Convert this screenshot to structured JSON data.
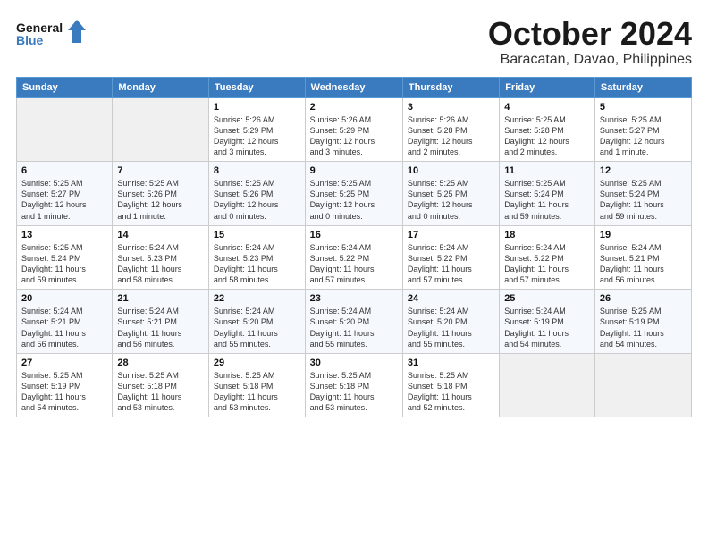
{
  "header": {
    "logo_line1": "General",
    "logo_line2": "Blue",
    "month": "October 2024",
    "location": "Baracatan, Davao, Philippines"
  },
  "weekdays": [
    "Sunday",
    "Monday",
    "Tuesday",
    "Wednesday",
    "Thursday",
    "Friday",
    "Saturday"
  ],
  "weeks": [
    [
      {
        "day": "",
        "info": ""
      },
      {
        "day": "",
        "info": ""
      },
      {
        "day": "1",
        "info": "Sunrise: 5:26 AM\nSunset: 5:29 PM\nDaylight: 12 hours\nand 3 minutes."
      },
      {
        "day": "2",
        "info": "Sunrise: 5:26 AM\nSunset: 5:29 PM\nDaylight: 12 hours\nand 3 minutes."
      },
      {
        "day": "3",
        "info": "Sunrise: 5:26 AM\nSunset: 5:28 PM\nDaylight: 12 hours\nand 2 minutes."
      },
      {
        "day": "4",
        "info": "Sunrise: 5:25 AM\nSunset: 5:28 PM\nDaylight: 12 hours\nand 2 minutes."
      },
      {
        "day": "5",
        "info": "Sunrise: 5:25 AM\nSunset: 5:27 PM\nDaylight: 12 hours\nand 1 minute."
      }
    ],
    [
      {
        "day": "6",
        "info": "Sunrise: 5:25 AM\nSunset: 5:27 PM\nDaylight: 12 hours\nand 1 minute."
      },
      {
        "day": "7",
        "info": "Sunrise: 5:25 AM\nSunset: 5:26 PM\nDaylight: 12 hours\nand 1 minute."
      },
      {
        "day": "8",
        "info": "Sunrise: 5:25 AM\nSunset: 5:26 PM\nDaylight: 12 hours\nand 0 minutes."
      },
      {
        "day": "9",
        "info": "Sunrise: 5:25 AM\nSunset: 5:25 PM\nDaylight: 12 hours\nand 0 minutes."
      },
      {
        "day": "10",
        "info": "Sunrise: 5:25 AM\nSunset: 5:25 PM\nDaylight: 12 hours\nand 0 minutes."
      },
      {
        "day": "11",
        "info": "Sunrise: 5:25 AM\nSunset: 5:24 PM\nDaylight: 11 hours\nand 59 minutes."
      },
      {
        "day": "12",
        "info": "Sunrise: 5:25 AM\nSunset: 5:24 PM\nDaylight: 11 hours\nand 59 minutes."
      }
    ],
    [
      {
        "day": "13",
        "info": "Sunrise: 5:25 AM\nSunset: 5:24 PM\nDaylight: 11 hours\nand 59 minutes."
      },
      {
        "day": "14",
        "info": "Sunrise: 5:24 AM\nSunset: 5:23 PM\nDaylight: 11 hours\nand 58 minutes."
      },
      {
        "day": "15",
        "info": "Sunrise: 5:24 AM\nSunset: 5:23 PM\nDaylight: 11 hours\nand 58 minutes."
      },
      {
        "day": "16",
        "info": "Sunrise: 5:24 AM\nSunset: 5:22 PM\nDaylight: 11 hours\nand 57 minutes."
      },
      {
        "day": "17",
        "info": "Sunrise: 5:24 AM\nSunset: 5:22 PM\nDaylight: 11 hours\nand 57 minutes."
      },
      {
        "day": "18",
        "info": "Sunrise: 5:24 AM\nSunset: 5:22 PM\nDaylight: 11 hours\nand 57 minutes."
      },
      {
        "day": "19",
        "info": "Sunrise: 5:24 AM\nSunset: 5:21 PM\nDaylight: 11 hours\nand 56 minutes."
      }
    ],
    [
      {
        "day": "20",
        "info": "Sunrise: 5:24 AM\nSunset: 5:21 PM\nDaylight: 11 hours\nand 56 minutes."
      },
      {
        "day": "21",
        "info": "Sunrise: 5:24 AM\nSunset: 5:21 PM\nDaylight: 11 hours\nand 56 minutes."
      },
      {
        "day": "22",
        "info": "Sunrise: 5:24 AM\nSunset: 5:20 PM\nDaylight: 11 hours\nand 55 minutes."
      },
      {
        "day": "23",
        "info": "Sunrise: 5:24 AM\nSunset: 5:20 PM\nDaylight: 11 hours\nand 55 minutes."
      },
      {
        "day": "24",
        "info": "Sunrise: 5:24 AM\nSunset: 5:20 PM\nDaylight: 11 hours\nand 55 minutes."
      },
      {
        "day": "25",
        "info": "Sunrise: 5:24 AM\nSunset: 5:19 PM\nDaylight: 11 hours\nand 54 minutes."
      },
      {
        "day": "26",
        "info": "Sunrise: 5:25 AM\nSunset: 5:19 PM\nDaylight: 11 hours\nand 54 minutes."
      }
    ],
    [
      {
        "day": "27",
        "info": "Sunrise: 5:25 AM\nSunset: 5:19 PM\nDaylight: 11 hours\nand 54 minutes."
      },
      {
        "day": "28",
        "info": "Sunrise: 5:25 AM\nSunset: 5:18 PM\nDaylight: 11 hours\nand 53 minutes."
      },
      {
        "day": "29",
        "info": "Sunrise: 5:25 AM\nSunset: 5:18 PM\nDaylight: 11 hours\nand 53 minutes."
      },
      {
        "day": "30",
        "info": "Sunrise: 5:25 AM\nSunset: 5:18 PM\nDaylight: 11 hours\nand 53 minutes."
      },
      {
        "day": "31",
        "info": "Sunrise: 5:25 AM\nSunset: 5:18 PM\nDaylight: 11 hours\nand 52 minutes."
      },
      {
        "day": "",
        "info": ""
      },
      {
        "day": "",
        "info": ""
      }
    ]
  ]
}
